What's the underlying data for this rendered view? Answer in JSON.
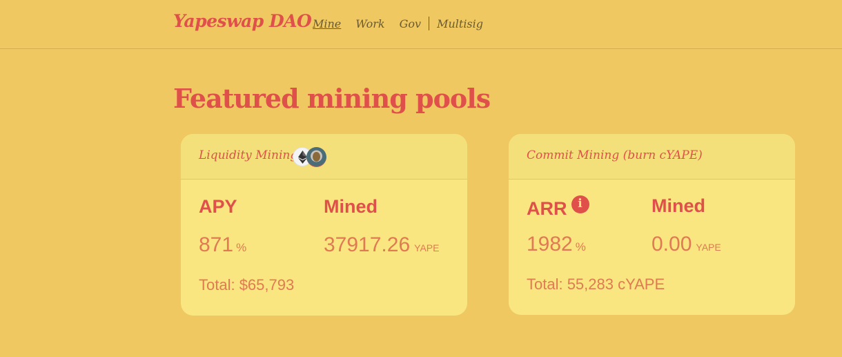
{
  "nav": {
    "brand": "Yapeswap DAO",
    "links": [
      {
        "label": "Mine",
        "active": true
      },
      {
        "label": "Work",
        "active": false
      },
      {
        "label": "Gov",
        "active": false
      },
      {
        "label": "Multisig",
        "active": false
      }
    ]
  },
  "page": {
    "title": "Featured mining pools"
  },
  "pools": [
    {
      "title": "Liquidity Mining",
      "icons": [
        "eth-icon",
        "ape-icon"
      ],
      "rate_label": "APY",
      "rate_value": "871",
      "rate_unit": "%",
      "mined_label": "Mined",
      "mined_value": "37917.26",
      "mined_unit": "YAPE",
      "total": "Total: $65,793"
    },
    {
      "title": "Commit Mining (burn cYAPE)",
      "icons": [
        "info-icon"
      ],
      "rate_label": "ARR",
      "rate_value": "1982",
      "rate_unit": "%",
      "mined_label": "Mined",
      "mined_value": "0.00",
      "mined_unit": "YAPE",
      "total": "Total: 55,283 cYAPE"
    }
  ],
  "colors": {
    "background": "#efc862",
    "card": "#fae680",
    "accent": "#e0504a",
    "value": "#e07a52"
  }
}
